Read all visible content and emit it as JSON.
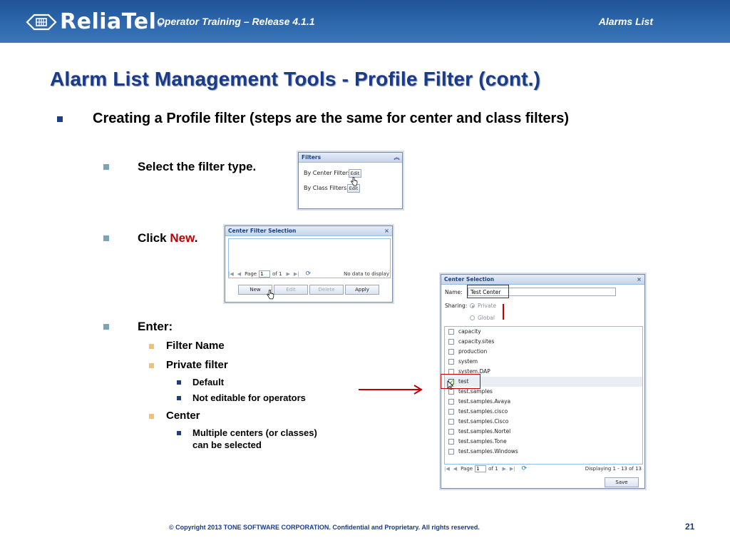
{
  "header": {
    "logo_text": "ReliaTel",
    "logo_tm": "®",
    "subtitle": "Operator Training – Release 4.1.1",
    "section": "Alarms List"
  },
  "slide": {
    "title": "Alarm List Management Tools - Profile Filter (cont.)",
    "bullet_main": "Creating a Profile filter (steps are the same for center and class filters)",
    "step1": "Select the filter type.",
    "step2_prefix": "Click ",
    "step2_new": "New",
    "step2_suffix": ".",
    "step3": "Enter:",
    "sub_filter_name": "Filter Name",
    "sub_private_filter": "Private filter",
    "sub_default": "Default",
    "sub_not_editable": "Not editable for operators",
    "sub_center": "Center",
    "sub_multiple_1": "Multiple centers (or classes)",
    "sub_multiple_2": "can be selected"
  },
  "filters_panel": {
    "title": "Filters",
    "collapse_icon": "double-chevron-up-icon",
    "center_label": "By Center Filters",
    "class_label": "By Class Filters",
    "edit_label": "Edit"
  },
  "center_filter_panel": {
    "title": "Center Filter Selection",
    "close_glyph": "×",
    "page_label": "Page",
    "page_value": "1",
    "of_label": "of 1",
    "status": "No data to display",
    "buttons": {
      "new": "New",
      "edit": "Edit",
      "delete": "Delete",
      "apply": "Apply"
    }
  },
  "center_selection_panel": {
    "title": "Center Selection",
    "close_glyph": "×",
    "name_label": "Name:",
    "name_value": "Test Center",
    "sharing_label": "Sharing:",
    "private_label": "Private",
    "global_label": "Global",
    "items": [
      {
        "label": "capacity",
        "checked": false
      },
      {
        "label": "capacity.sites",
        "checked": false
      },
      {
        "label": "production",
        "checked": false
      },
      {
        "label": "system",
        "checked": false
      },
      {
        "label": "system.DAP",
        "checked": false
      },
      {
        "label": "test",
        "checked": true
      },
      {
        "label": "test.samples",
        "checked": false
      },
      {
        "label": "test.samples.Avaya",
        "checked": false
      },
      {
        "label": "test.samples.cisco",
        "checked": false
      },
      {
        "label": "test.samples.Cisco",
        "checked": false
      },
      {
        "label": "test.samples.Nortel",
        "checked": false
      },
      {
        "label": "test.samples.Tone",
        "checked": false
      },
      {
        "label": "test.samples.Windows",
        "checked": false
      }
    ],
    "page_label": "Page",
    "page_value": "1",
    "of_label": "of 1",
    "status": "Displaying 1 - 13 of 13",
    "save_label": "Save"
  },
  "footer": {
    "copyright": "© Copyright 2013 TONE SOFTWARE CORPORATION. Confidential and Proprietary. All rights reserved.",
    "page_number": "21"
  },
  "colors": {
    "header_blue": "#2f68ad",
    "title_navy": "#1a3a8a",
    "highlight_red": "#c00000"
  }
}
